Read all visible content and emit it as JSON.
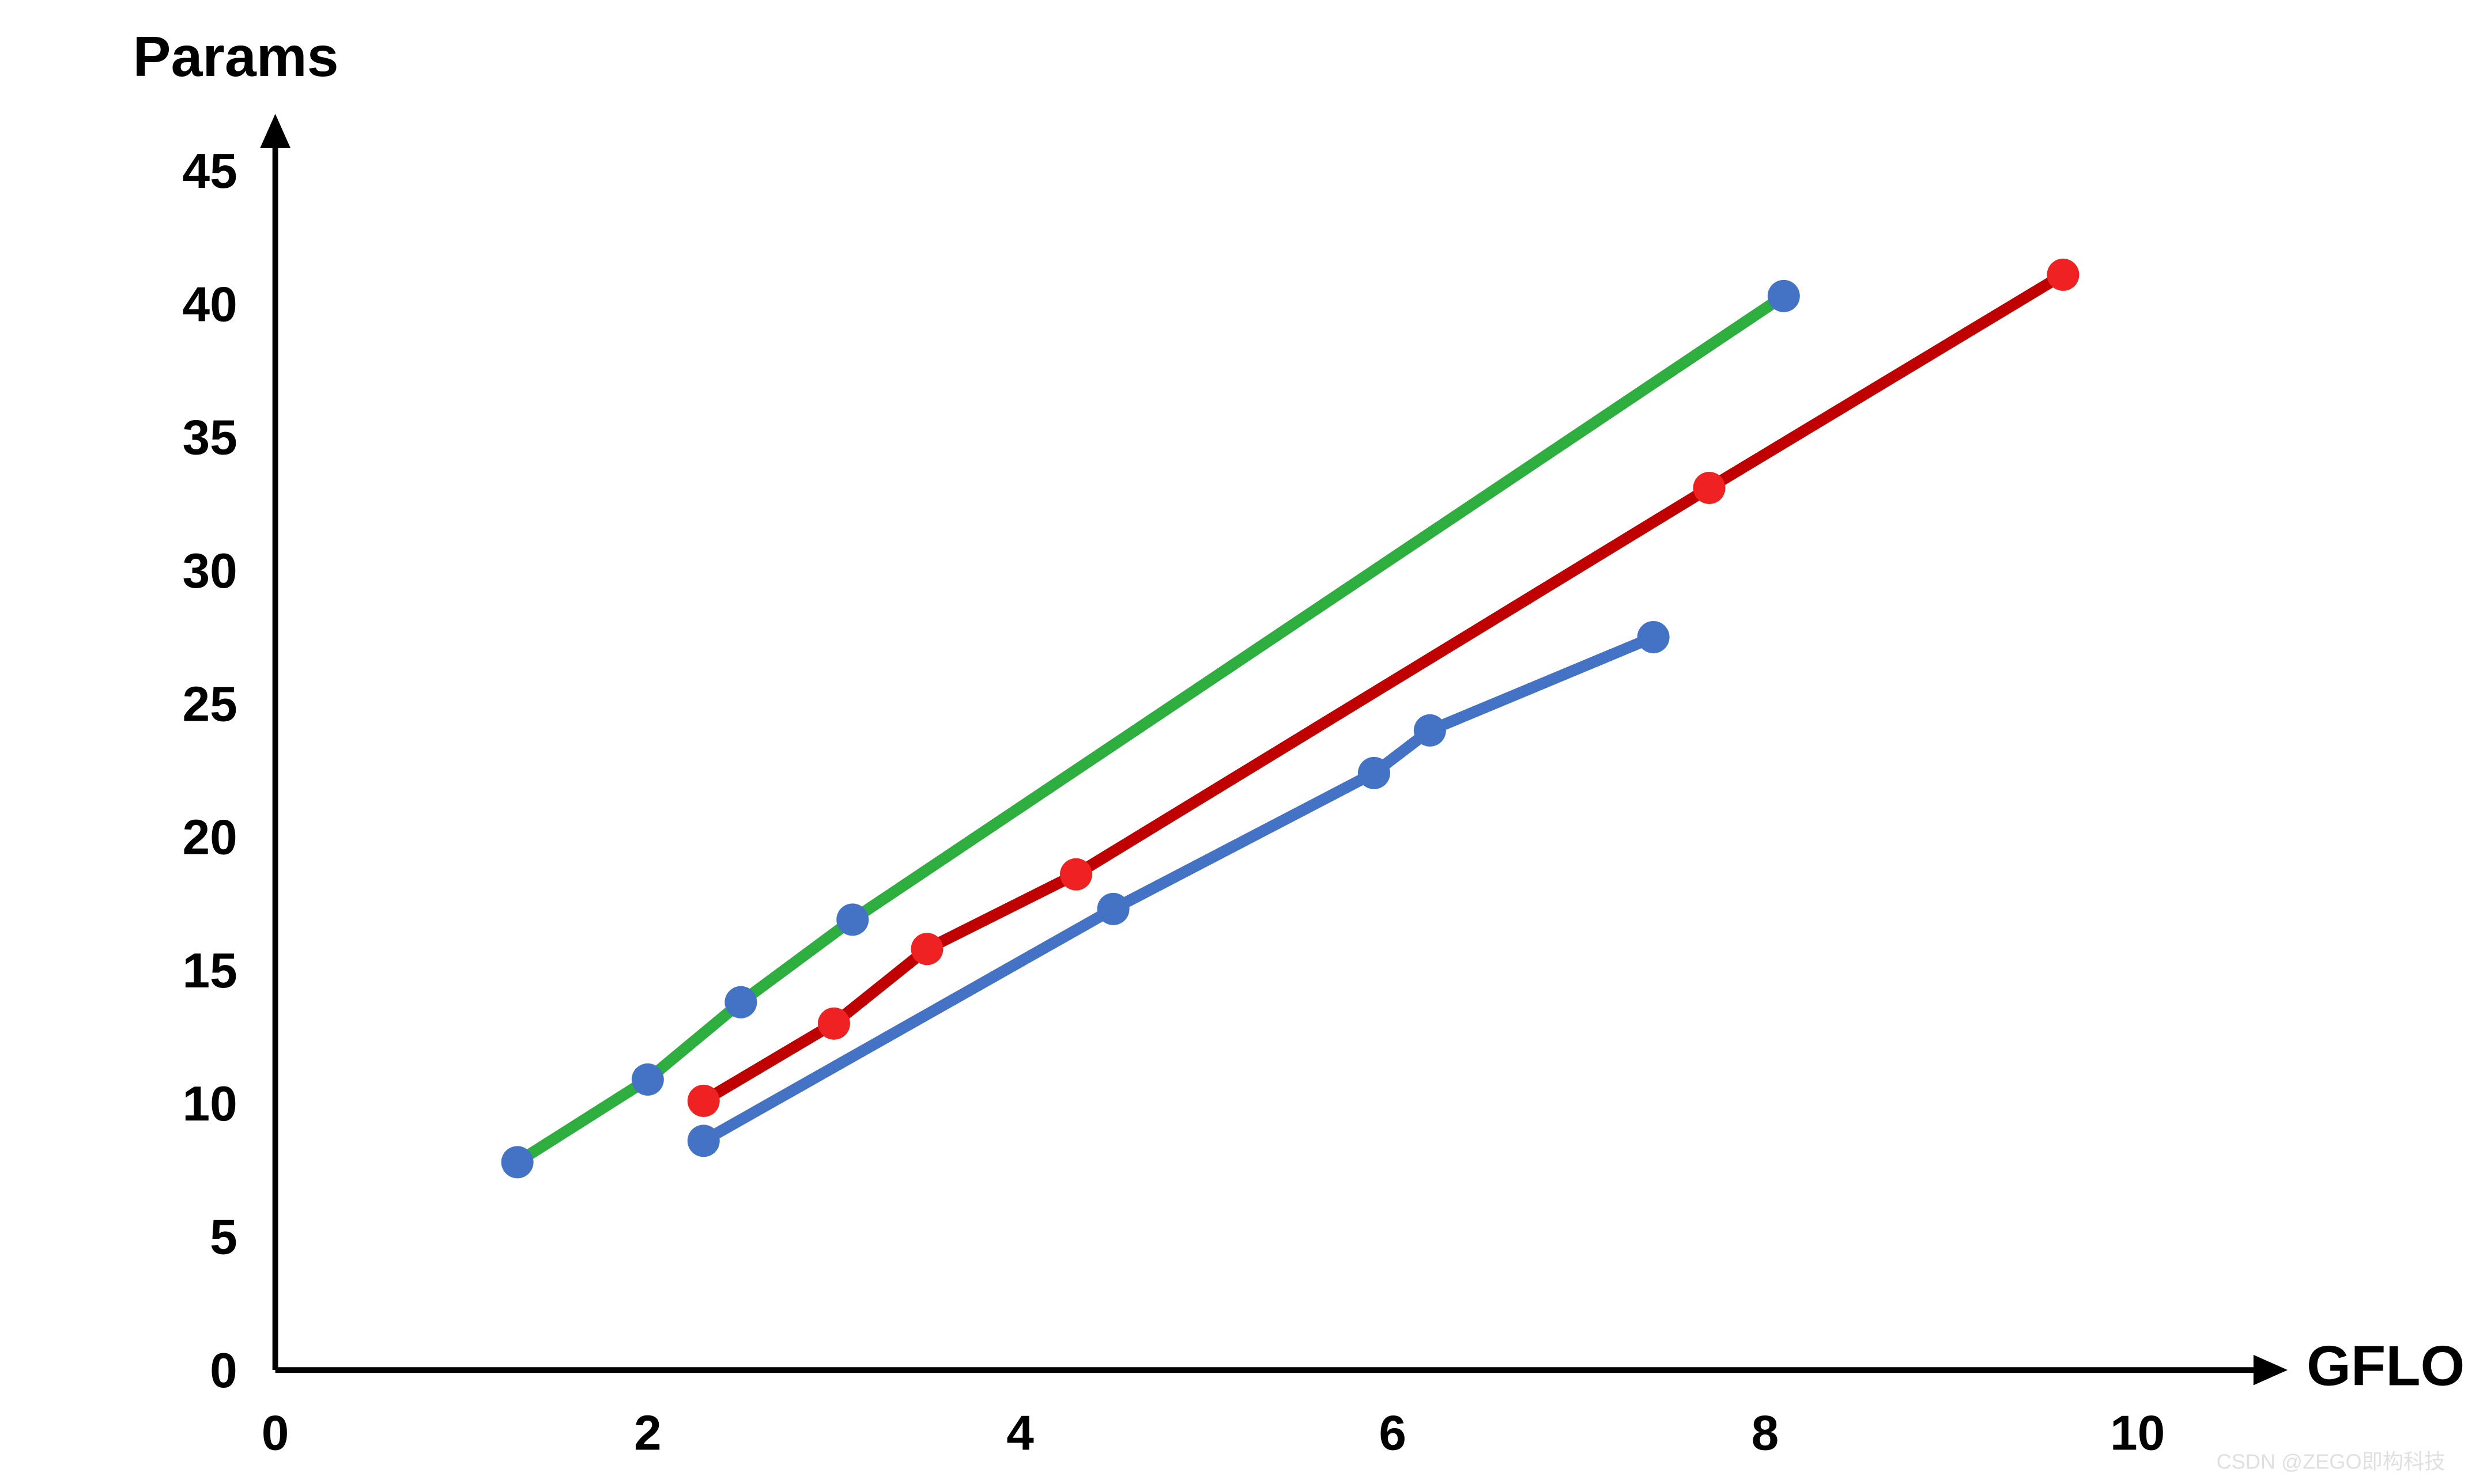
{
  "chart_data": {
    "type": "line",
    "xlabel": "GFLOPs",
    "ylabel": "Params",
    "xlim": [
      0,
      10.5
    ],
    "ylim": [
      0,
      45
    ],
    "xticks": [
      0,
      2,
      4,
      6,
      8,
      10
    ],
    "yticks": [
      0,
      5,
      10,
      15,
      20,
      25,
      30,
      35,
      40,
      45
    ],
    "series": [
      {
        "name": "green",
        "color": "#2eae3f",
        "marker_color": "#4472c4",
        "points": [
          {
            "x": 1.3,
            "y": 7.8
          },
          {
            "x": 2.0,
            "y": 10.9
          },
          {
            "x": 2.5,
            "y": 13.8
          },
          {
            "x": 3.1,
            "y": 16.9
          },
          {
            "x": 8.1,
            "y": 40.3
          }
        ]
      },
      {
        "name": "red",
        "color": "#c00000",
        "marker_color": "#ee2222",
        "points": [
          {
            "x": 2.3,
            "y": 10.1
          },
          {
            "x": 3.0,
            "y": 13.0
          },
          {
            "x": 3.5,
            "y": 15.8
          },
          {
            "x": 4.3,
            "y": 18.6
          },
          {
            "x": 7.7,
            "y": 33.1
          },
          {
            "x": 9.6,
            "y": 41.1
          }
        ]
      },
      {
        "name": "blue",
        "color": "#4472c4",
        "marker_color": "#4472c4",
        "points": [
          {
            "x": 2.3,
            "y": 8.6
          },
          {
            "x": 4.5,
            "y": 17.3
          },
          {
            "x": 5.9,
            "y": 22.4
          },
          {
            "x": 6.2,
            "y": 24.0
          },
          {
            "x": 7.4,
            "y": 27.5
          }
        ]
      }
    ]
  },
  "watermark": "CSDN @ZEGO即构科技"
}
